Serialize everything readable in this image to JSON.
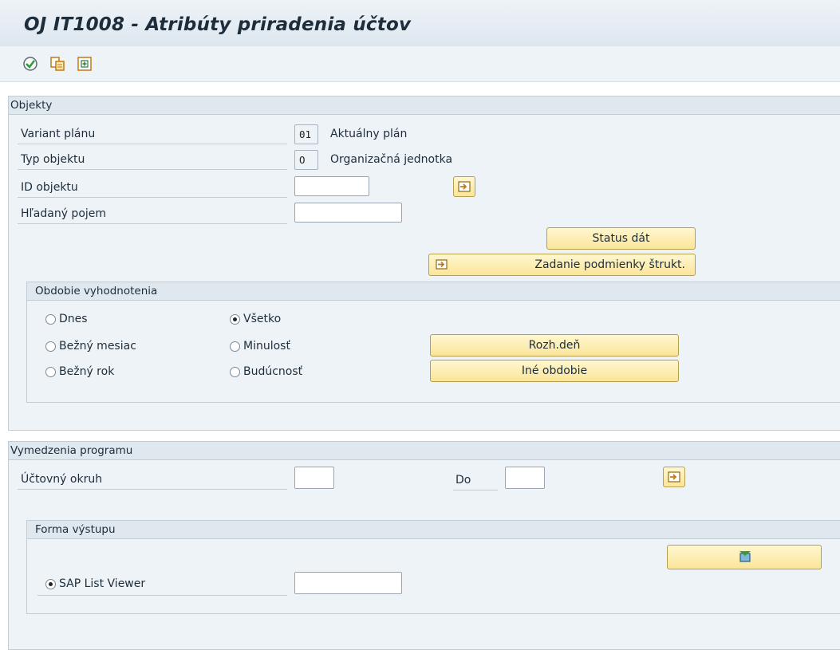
{
  "window": {
    "title": "OJ IT1008 - Atribúty priradenia účtov"
  },
  "toolbar": {
    "icons": [
      "execute-icon",
      "get-variant-icon",
      "selection-options-icon"
    ]
  },
  "objects": {
    "title": "Objekty",
    "plan_variant": {
      "label": "Variant plánu",
      "value": "01",
      "text": "Aktuálny plán"
    },
    "object_type": {
      "label": "Typ objektu",
      "value": "O",
      "text": "Organizačná jednotka"
    },
    "object_id": {
      "label": "ID objektu",
      "value": ""
    },
    "search_term": {
      "label": "Hľadaný pojem",
      "value": ""
    },
    "status_button": "Status dát",
    "structure_button": "Zadanie podmienky štrukt."
  },
  "period": {
    "title": "Obdobie vyhodnotenia",
    "options": [
      "Dnes",
      "Bežný mesiac",
      "Bežný rok",
      "Všetko",
      "Minulosť",
      "Budúcnosť"
    ],
    "selected": "Všetko",
    "key_date_button": "Rozh.deň",
    "other_period_button": "Iné obdobie"
  },
  "program": {
    "title": "Vymedzenia programu",
    "company_code": {
      "label": "Účtovný okruh",
      "value": ""
    },
    "to": {
      "label": "Do",
      "value": ""
    }
  },
  "output": {
    "title": "Forma výstupu",
    "alv": {
      "label": "SAP List Viewer",
      "selected": true,
      "value": ""
    }
  }
}
